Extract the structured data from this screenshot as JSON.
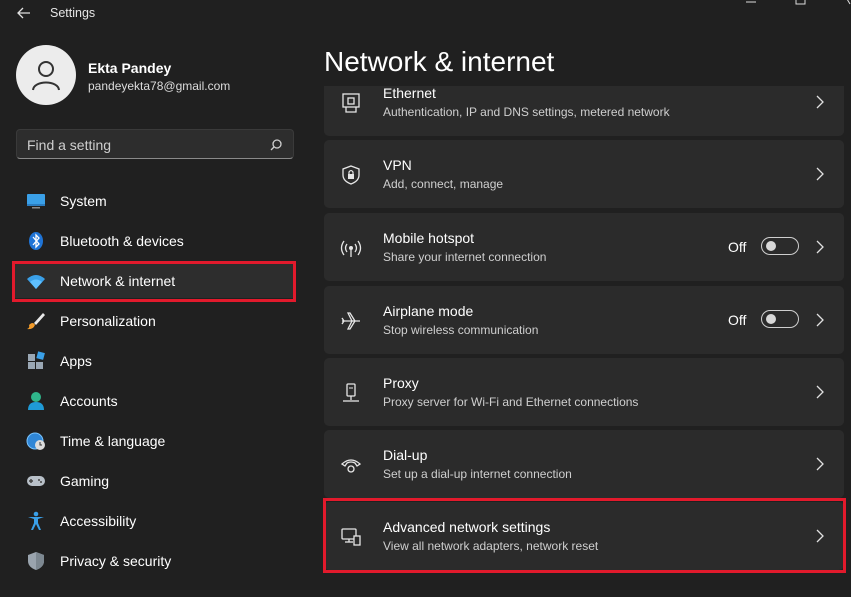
{
  "window": {
    "title": "Settings",
    "controls": [
      "minimize",
      "maximize",
      "close"
    ]
  },
  "user": {
    "name": "Ekta Pandey",
    "email": "pandeyekta78@gmail.com"
  },
  "search": {
    "placeholder": "Find a setting",
    "icon": "search-icon"
  },
  "sidebar": {
    "items": [
      {
        "label": "System",
        "icon": "system-icon"
      },
      {
        "label": "Bluetooth & devices",
        "icon": "bluetooth-icon"
      },
      {
        "label": "Network & internet",
        "icon": "wifi-icon",
        "active": true
      },
      {
        "label": "Personalization",
        "icon": "brush-icon"
      },
      {
        "label": "Apps",
        "icon": "apps-icon"
      },
      {
        "label": "Accounts",
        "icon": "accounts-icon"
      },
      {
        "label": "Time & language",
        "icon": "globe-clock-icon"
      },
      {
        "label": "Gaming",
        "icon": "gamepad-icon"
      },
      {
        "label": "Accessibility",
        "icon": "accessibility-icon"
      },
      {
        "label": "Privacy & security",
        "icon": "shield-icon"
      }
    ]
  },
  "main": {
    "title": "Network & internet",
    "cards": [
      {
        "title": "Ethernet",
        "subtitle": "Authentication, IP and DNS settings, metered network",
        "icon": "ethernet-icon"
      },
      {
        "title": "VPN",
        "subtitle": "Add, connect, manage",
        "icon": "vpn-shield-icon"
      },
      {
        "title": "Mobile hotspot",
        "subtitle": "Share your internet connection",
        "icon": "hotspot-icon",
        "toggle": "Off"
      },
      {
        "title": "Airplane mode",
        "subtitle": "Stop wireless communication",
        "icon": "airplane-icon",
        "toggle": "Off"
      },
      {
        "title": "Proxy",
        "subtitle": "Proxy server for Wi-Fi and Ethernet connections",
        "icon": "proxy-icon"
      },
      {
        "title": "Dial-up",
        "subtitle": "Set up a dial-up internet connection",
        "icon": "dialup-icon"
      },
      {
        "title": "Advanced network settings",
        "subtitle": "View all network adapters, network reset",
        "icon": "network-pc-icon"
      }
    ]
  },
  "colors": {
    "background": "#202020",
    "card": "#2b2b2b",
    "accent": "#4cc2ff",
    "highlight": "#e21a2c"
  }
}
